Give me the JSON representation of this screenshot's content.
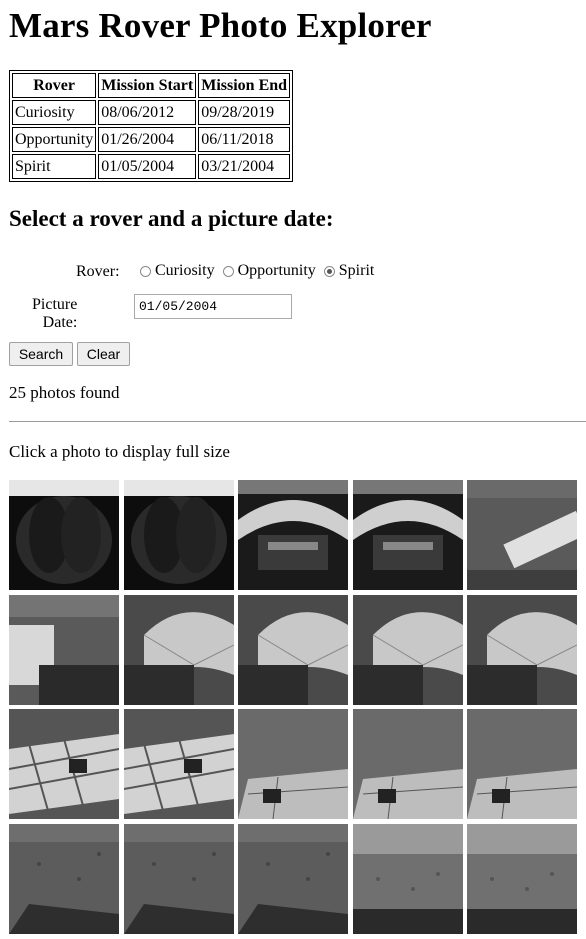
{
  "page_title": "Mars Rover Photo Explorer",
  "missions_table": {
    "headers": [
      "Rover",
      "Mission Start",
      "Mission End"
    ],
    "rows": [
      [
        "Curiosity",
        "08/06/2012",
        "09/28/2019"
      ],
      [
        "Opportunity",
        "01/26/2004",
        "06/11/2018"
      ],
      [
        "Spirit",
        "01/05/2004",
        "03/21/2004"
      ]
    ]
  },
  "form": {
    "heading": "Select a rover and a picture date:",
    "rover_label": "Rover:",
    "rovers": [
      {
        "label": "Curiosity",
        "checked": false
      },
      {
        "label": "Opportunity",
        "checked": false
      },
      {
        "label": "Spirit",
        "checked": true
      }
    ],
    "date_label": "Picture Date:",
    "date_value": "01/05/2004",
    "search_label": "Search",
    "clear_label": "Clear"
  },
  "results": {
    "count_text": "25 photos found",
    "hint_text": "Click a photo to display full size"
  },
  "colors": {
    "photo_dark": "#1a1a1a",
    "photo_mid": "#5a5a5a",
    "photo_light": "#c8c8c8"
  },
  "photos": [
    {
      "kind": "dome"
    },
    {
      "kind": "dome"
    },
    {
      "kind": "deck"
    },
    {
      "kind": "deck"
    },
    {
      "kind": "arm"
    },
    {
      "kind": "arm-left"
    },
    {
      "kind": "airbag"
    },
    {
      "kind": "airbag"
    },
    {
      "kind": "airbag"
    },
    {
      "kind": "airbag"
    },
    {
      "kind": "grid"
    },
    {
      "kind": "grid"
    },
    {
      "kind": "panel"
    },
    {
      "kind": "panel"
    },
    {
      "kind": "panel"
    },
    {
      "kind": "ground"
    },
    {
      "kind": "ground"
    },
    {
      "kind": "ground"
    },
    {
      "kind": "horizon"
    },
    {
      "kind": "horizon"
    }
  ]
}
